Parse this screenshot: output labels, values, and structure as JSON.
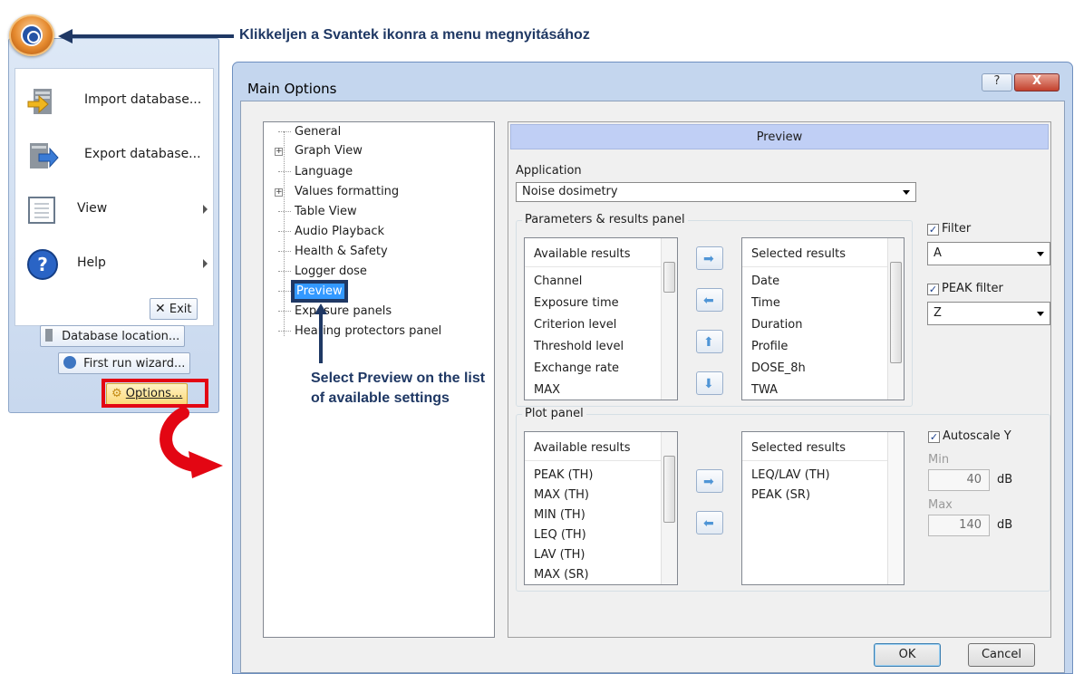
{
  "annotation": {
    "text": "Klikkeljen a Svantek ikonra a menu megnyitásához"
  },
  "app_menu": {
    "items": [
      {
        "label": "Import database...",
        "icon": "import-database-icon"
      },
      {
        "label": "Export database...",
        "icon": "export-database-icon"
      },
      {
        "label": "View",
        "icon": "view-icon"
      },
      {
        "label": "Help",
        "icon": "help-icon"
      }
    ],
    "exit_label": "Exit",
    "db_location_label": "Database location...",
    "first_run_label": "First run wizard...",
    "options_label": "Options..."
  },
  "dialog": {
    "title": "Main Options",
    "help_glyph": "?",
    "close_glyph": "X",
    "tree": {
      "items": [
        "General",
        "Graph View",
        "Language",
        "Values formatting",
        "Table View",
        "Audio Playback",
        "Health & Safety",
        "Logger dose",
        "Preview",
        "Exposure panels",
        "Hearing protectors panel"
      ],
      "selected": "Preview",
      "annotation": "Select Preview on the list of available settings"
    },
    "panel": {
      "header": "Preview",
      "application_label": "Application",
      "application_value": "Noise dosimetry",
      "params_group": "Parameters & results panel",
      "params_available_header": "Available results",
      "params_available": [
        "Channel",
        "Exposure time",
        "Criterion level",
        "Threshold level",
        "Exchange rate",
        "MAX"
      ],
      "params_selected_header": "Selected results",
      "params_selected": [
        "Date",
        "Time",
        "Duration",
        "Profile",
        "DOSE_8h",
        "TWA"
      ],
      "filter_label": "Filter",
      "filter_value": "A",
      "peak_filter_label": "PEAK filter",
      "peak_filter_value": "Z",
      "plot_group": "Plot panel",
      "plot_available_header": "Available results",
      "plot_available": [
        "PEAK (TH)",
        "MAX (TH)",
        "MIN (TH)",
        "LEQ (TH)",
        "LAV (TH)",
        "MAX (SR)"
      ],
      "plot_selected_header": "Selected results",
      "plot_selected": [
        "LEQ/LAV (TH)",
        "PEAK (SR)"
      ],
      "autoscale_label": "Autoscale Y",
      "min_label": "Min",
      "min_value": "40",
      "max_label": "Max",
      "max_value": "140",
      "unit": "dB"
    },
    "ok_label": "OK",
    "cancel_label": "Cancel"
  },
  "colors": {
    "annotation": "#1f3864",
    "highlight": "#e30613",
    "panel_header": "#c0cff5",
    "selection": "#3399ff"
  }
}
